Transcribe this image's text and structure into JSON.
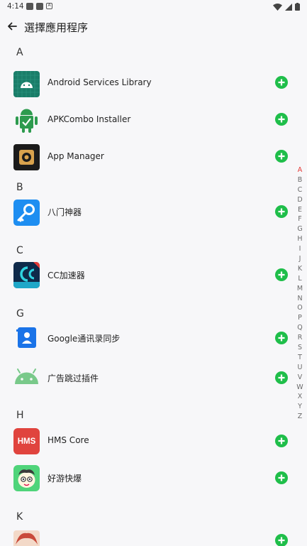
{
  "status_bar": {
    "time": "4:14"
  },
  "header": {
    "title": "選擇應用程序"
  },
  "sections": [
    {
      "letter": "A",
      "apps": [
        {
          "name": "Android Services Library",
          "icon": "android-services-icon"
        },
        {
          "name": "APKCombo Installer",
          "icon": "apkcombo-icon"
        },
        {
          "name": "App Manager",
          "icon": "app-manager-icon"
        }
      ]
    },
    {
      "letter": "B",
      "apps": [
        {
          "name": "八门神器",
          "icon": "bamen-icon"
        }
      ]
    },
    {
      "letter": "C",
      "apps": [
        {
          "name": "CC加速器",
          "icon": "cc-accelerator-icon"
        }
      ]
    },
    {
      "letter": "G",
      "apps": [
        {
          "name": "Google通讯录同步",
          "icon": "google-contacts-icon"
        },
        {
          "name": "广告跳过插件",
          "icon": "android-generic-icon"
        }
      ]
    },
    {
      "letter": "H",
      "apps": [
        {
          "name": "HMS Core",
          "icon": "hms-core-icon",
          "icon_text": "HMS"
        },
        {
          "name": "好游快爆",
          "icon": "haoyou-icon"
        }
      ]
    },
    {
      "letter": "K",
      "apps": [
        {
          "name": "",
          "icon": "anime-avatar-icon"
        }
      ]
    }
  ],
  "index_bar": {
    "letters": [
      "A",
      "B",
      "C",
      "D",
      "E",
      "F",
      "G",
      "H",
      "I",
      "J",
      "K",
      "L",
      "M",
      "N",
      "O",
      "P",
      "Q",
      "R",
      "S",
      "T",
      "U",
      "V",
      "W",
      "X",
      "Y",
      "Z"
    ],
    "active": "A"
  },
  "colors": {
    "accent_green": "#1fbe4a",
    "active_index": "#e53935"
  }
}
